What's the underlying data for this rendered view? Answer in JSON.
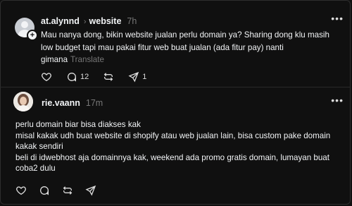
{
  "post": {
    "username": "at.alynnd",
    "topic": "website",
    "time": "7h",
    "text": "Mau nanya dong, bikin website jualan perlu domain ya? Sharing dong klu masih low budget tapi mau pakai fitur web buat jualan (ada fitur pay) nanti gimana",
    "translate_label": "Translate",
    "actions": {
      "like_icon": "heart-icon",
      "reply_icon": "comment-icon",
      "reply_count": "12",
      "repost_icon": "repost-icon",
      "share_icon": "share-icon",
      "share_count": "1"
    }
  },
  "reply": {
    "username": "rie.vaann",
    "time": "17m",
    "lines": [
      "perlu domain biar bisa diakses kak",
      "misal kakak udh buat website di shopify atau web jualan lain, bisa custom pake domain kakak sendiri",
      "beli di idwebhost aja domainnya kak, weekend ada promo gratis domain, lumayan buat coba2 dulu"
    ],
    "actions": {
      "like_icon": "heart-icon",
      "reply_icon": "comment-icon",
      "repost_icon": "repost-icon",
      "share_icon": "share-icon"
    }
  },
  "colors": {
    "background": "#101010",
    "text": "#f3f5f7",
    "muted": "#777777",
    "divider": "#2a2a2a"
  }
}
